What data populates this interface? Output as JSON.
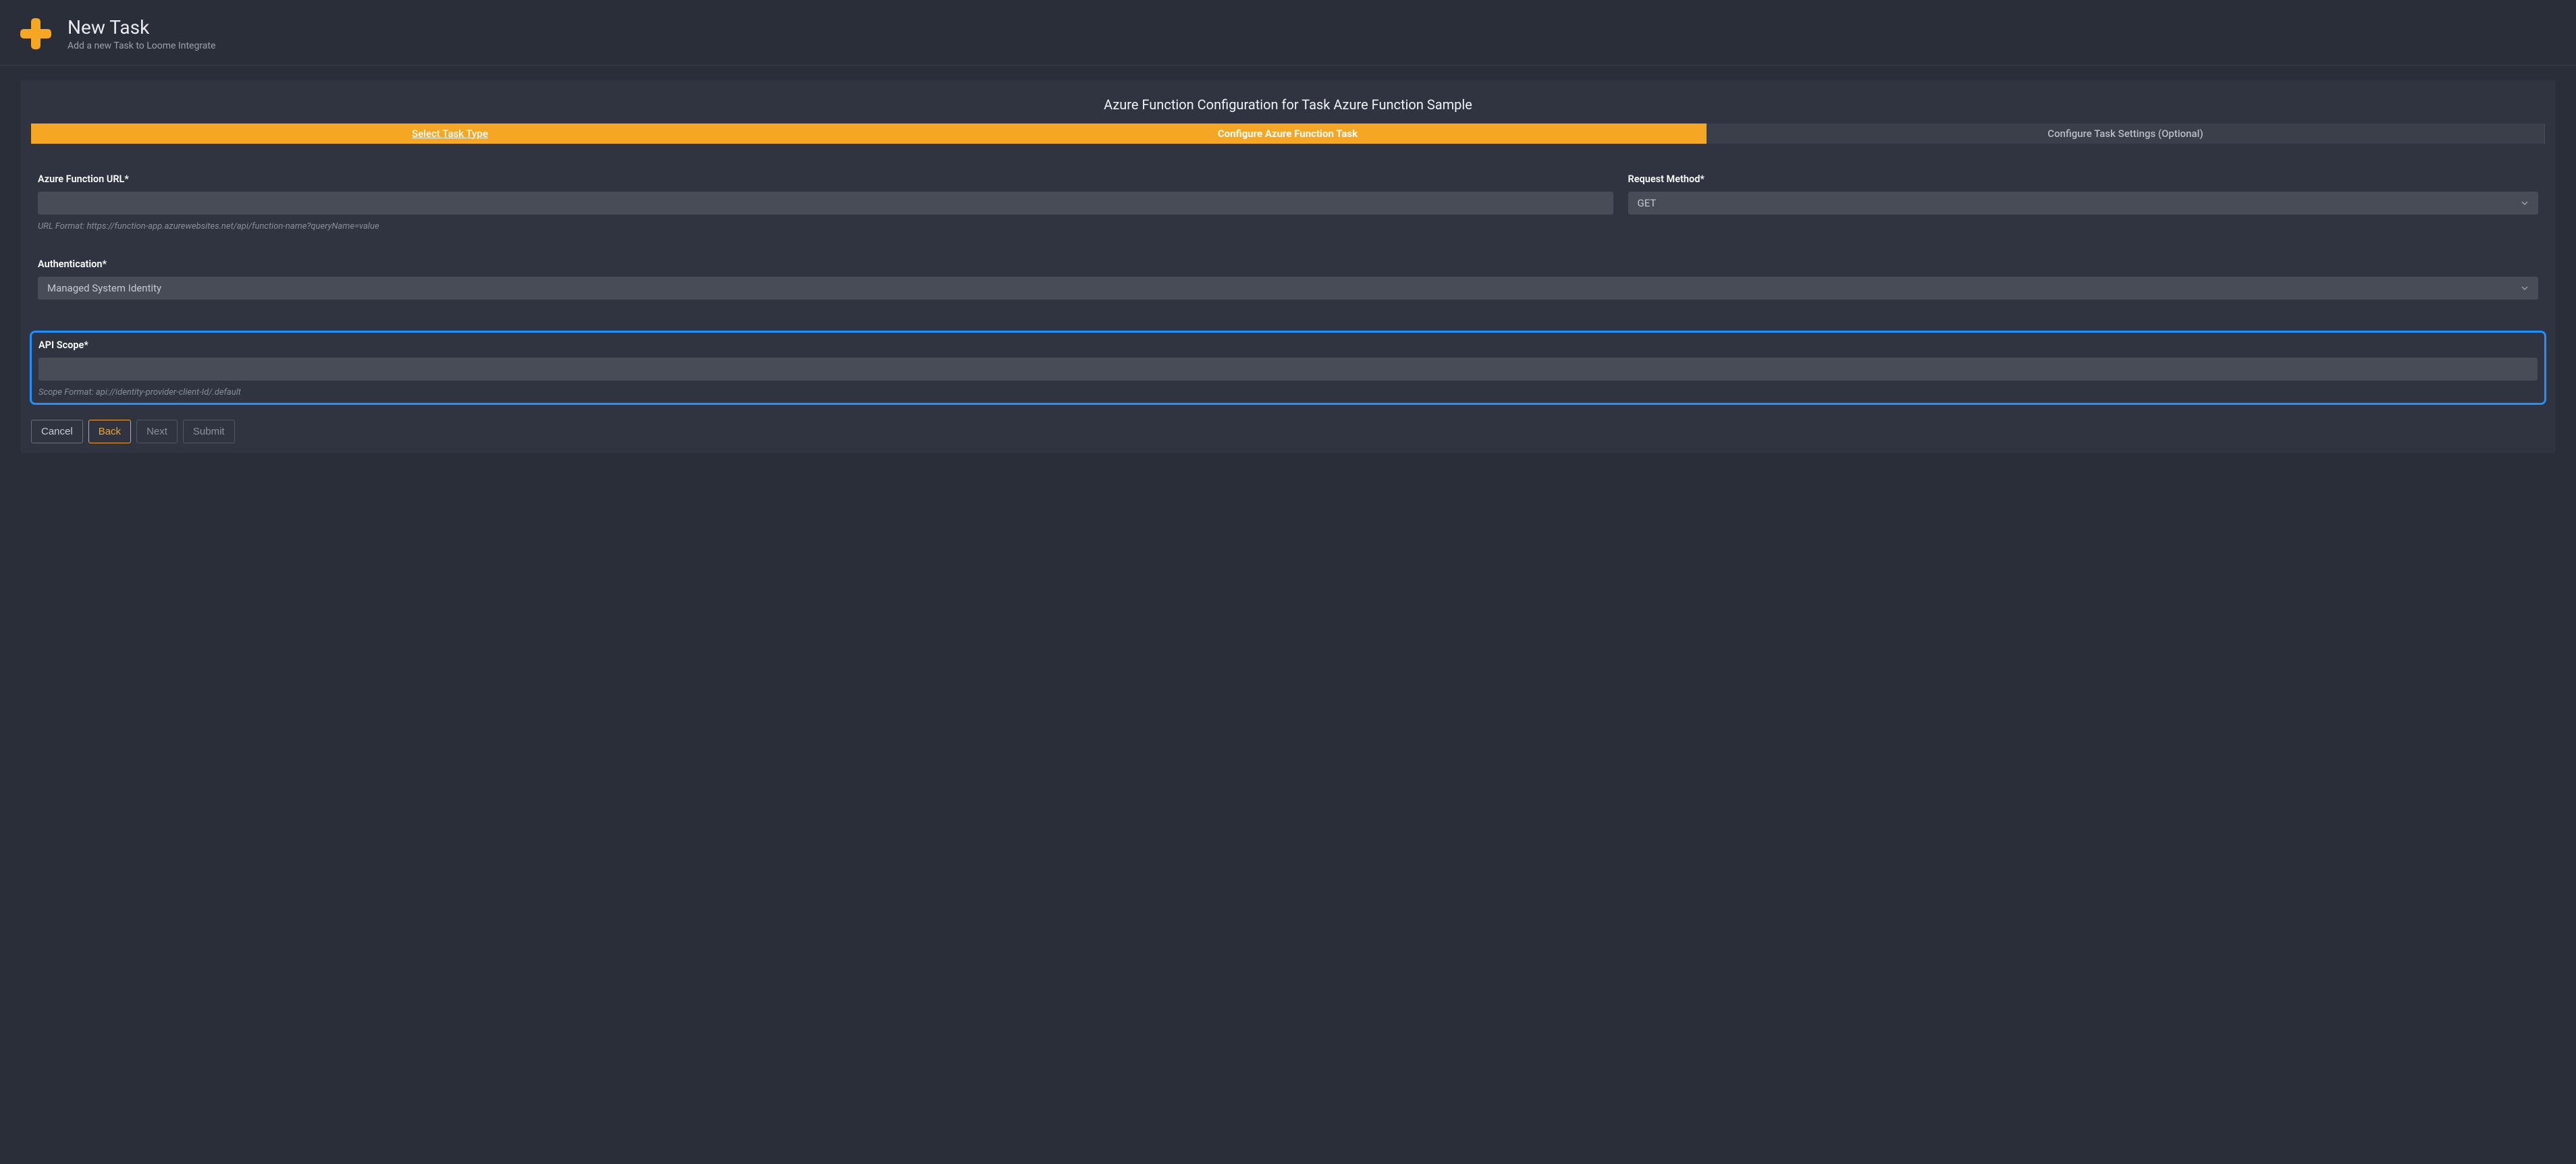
{
  "header": {
    "title": "New Task",
    "subtitle": "Add a new Task to Loome Integrate"
  },
  "panel": {
    "title": "Azure Function Configuration for Task Azure Function Sample"
  },
  "tabs": [
    {
      "label": "Select Task Type",
      "state": "done"
    },
    {
      "label": "Configure Azure Function Task",
      "state": "current"
    },
    {
      "label": "Configure Task Settings (Optional)",
      "state": "pending"
    }
  ],
  "form": {
    "url": {
      "label": "Azure Function URL*",
      "value": "",
      "hint": "URL Format: https://function-app.azurewebsites.net/api/function-name?queryName=value"
    },
    "method": {
      "label": "Request Method*",
      "value": "GET"
    },
    "auth": {
      "label": "Authentication*",
      "value": "Managed System Identity"
    },
    "scope": {
      "label": "API Scope*",
      "value": "",
      "hint": "Scope Format: api://identity-provider-client-Id/.default"
    }
  },
  "actions": {
    "cancel": "Cancel",
    "back": "Back",
    "next": "Next",
    "submit": "Submit"
  },
  "colors": {
    "accent": "#f5a623",
    "highlight": "#1e90ff"
  }
}
